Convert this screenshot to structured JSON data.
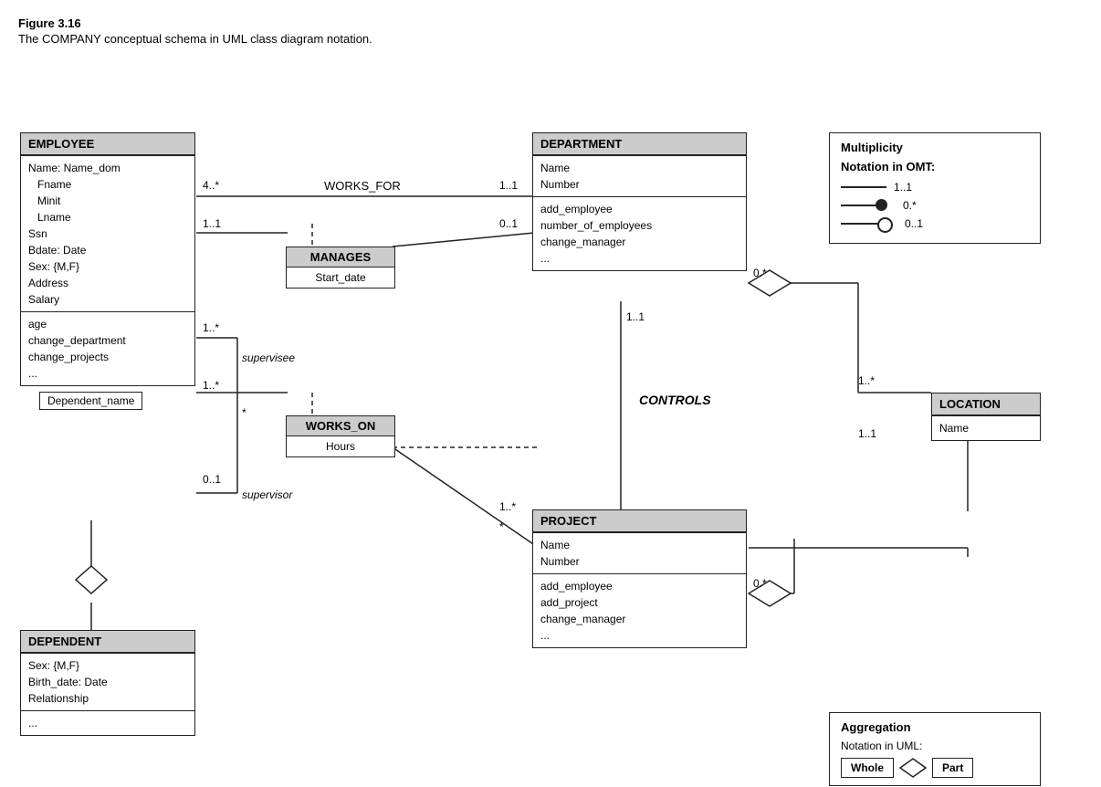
{
  "figure": {
    "title": "Figure 3.16",
    "caption": "The COMPANY conceptual schema in UML class diagram notation."
  },
  "classes": {
    "employee": {
      "header": "EMPLOYEE",
      "attributes": [
        "Name: Name_dom",
        "   Fname",
        "   Minit",
        "   Lname",
        "Ssn",
        "Bdate: Date",
        "Sex: {M,F}",
        "Address",
        "Salary"
      ],
      "methods": [
        "age",
        "change_department",
        "change_projects",
        "..."
      ],
      "extra": "Dependent_name"
    },
    "department": {
      "header": "DEPARTMENT",
      "attributes": [
        "Name",
        "Number"
      ],
      "methods": [
        "add_employee",
        "number_of_employees",
        "change_manager",
        "..."
      ]
    },
    "project": {
      "header": "PROJECT",
      "attributes": [
        "Name",
        "Number"
      ],
      "methods": [
        "add_employee",
        "add_project",
        "change_manager",
        "..."
      ]
    },
    "dependent": {
      "header": "DEPENDENT",
      "attributes": [
        "Sex: {M,F}",
        "Birth_date: Date",
        "Relationship"
      ],
      "methods": [
        "..."
      ]
    },
    "location": {
      "header": "LOCATION",
      "attributes": [
        "Name"
      ]
    }
  },
  "assocBoxes": {
    "manages": {
      "header": "MANAGES",
      "body": "Start_date"
    },
    "worksOn": {
      "header": "WORKS_ON",
      "body": "Hours"
    }
  },
  "labels": {
    "works_for": "WORKS_FOR",
    "controls": "CONTROLS",
    "supervisee": "supervisee",
    "supervisor": "supervisor",
    "mult_4star": "4..*",
    "mult_11a": "1..1",
    "mult_11b": "1..1",
    "mult_01a": "0..1",
    "mult_1star_a": "1..*",
    "mult_star_a": "*",
    "mult_01b": "0..1",
    "mult_11c": "1..1",
    "mult_0star_a": "0.*",
    "mult_1star_b": "1..*",
    "mult_star_b": "*",
    "mult_0star_b": "0.*",
    "mult_1star_c": "1..*",
    "mult_11d": "1..1"
  },
  "multiplicity_notation": {
    "title": "Multiplicity",
    "subtitle": "Notation in OMT:",
    "rows": [
      {
        "label": "1..1"
      },
      {
        "label": "0.*"
      },
      {
        "label": "0..1"
      }
    ]
  },
  "aggregation_notation": {
    "title": "Aggregation",
    "subtitle": "Notation in UML:",
    "whole_label": "Whole",
    "part_label": "Part"
  }
}
